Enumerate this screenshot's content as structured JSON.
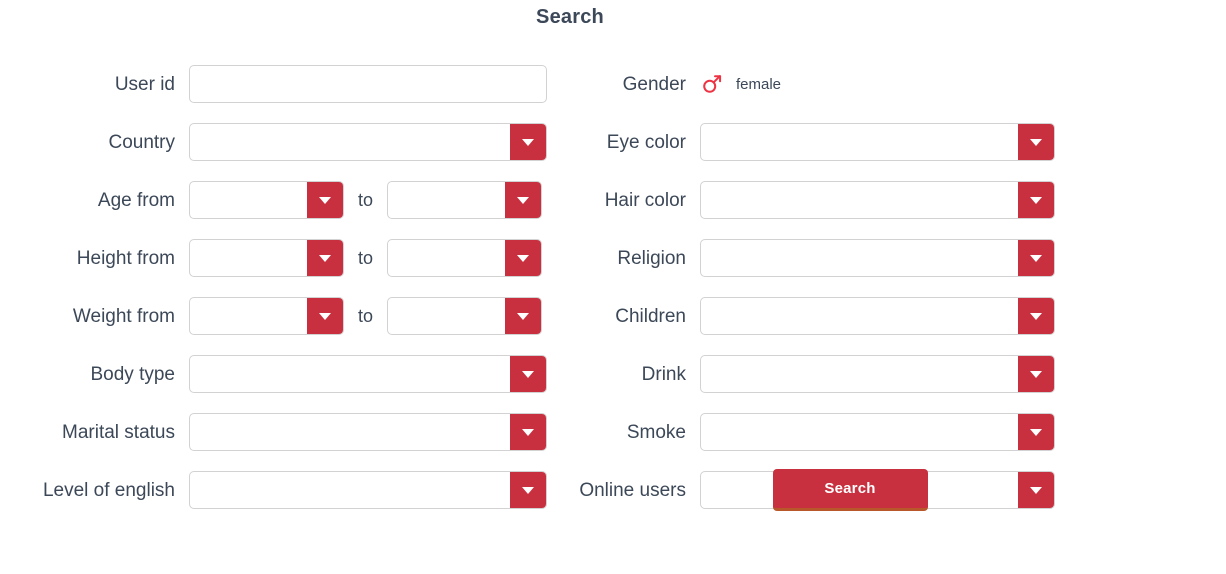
{
  "page": {
    "title": "Search",
    "accent_color": "#c9303f",
    "label_color": "#3c4858",
    "background": "#ffffff",
    "border_color": "#d2d2d2"
  },
  "left_column": {
    "rows": [
      {
        "label": "User id",
        "type": "text",
        "value": "",
        "placeholder": ""
      },
      {
        "label": "Country",
        "type": "select",
        "value": "",
        "icon": "chevron-down-icon"
      },
      {
        "label": "Age from",
        "type": "range",
        "separator": "to",
        "from_value": "",
        "to_value": "",
        "icon": "chevron-down-icon"
      },
      {
        "label": "Height from",
        "type": "range",
        "separator": "to",
        "from_value": "",
        "to_value": "",
        "icon": "chevron-down-icon"
      },
      {
        "label": "Weight from",
        "type": "range",
        "separator": "to",
        "from_value": "",
        "to_value": "",
        "icon": "chevron-down-icon"
      },
      {
        "label": "Body type",
        "type": "select",
        "value": "",
        "icon": "chevron-down-icon"
      },
      {
        "label": "Marital status",
        "type": "select",
        "value": "",
        "icon": "chevron-down-icon"
      },
      {
        "label": "Level of english",
        "type": "select",
        "value": "",
        "icon": "chevron-down-icon"
      }
    ]
  },
  "right_column": {
    "rows": [
      {
        "label": "Gender",
        "type": "gender",
        "icon": "mars-gender-icon",
        "icon_color": "#ee3344",
        "value": "female"
      },
      {
        "label": "Eye color",
        "type": "select",
        "value": "",
        "icon": "chevron-down-icon"
      },
      {
        "label": "Hair color",
        "type": "select",
        "value": "",
        "icon": "chevron-down-icon"
      },
      {
        "label": "Religion",
        "type": "select",
        "value": "",
        "icon": "chevron-down-icon"
      },
      {
        "label": "Children",
        "type": "select",
        "value": "",
        "icon": "chevron-down-icon"
      },
      {
        "label": "Drink",
        "type": "select",
        "value": "",
        "icon": "chevron-down-icon"
      },
      {
        "label": "Smoke",
        "type": "select",
        "value": "",
        "icon": "chevron-down-icon"
      },
      {
        "label": "Online users",
        "type": "select",
        "value": "",
        "icon": "chevron-down-icon"
      }
    ]
  },
  "actions": {
    "search_label": "Search"
  }
}
